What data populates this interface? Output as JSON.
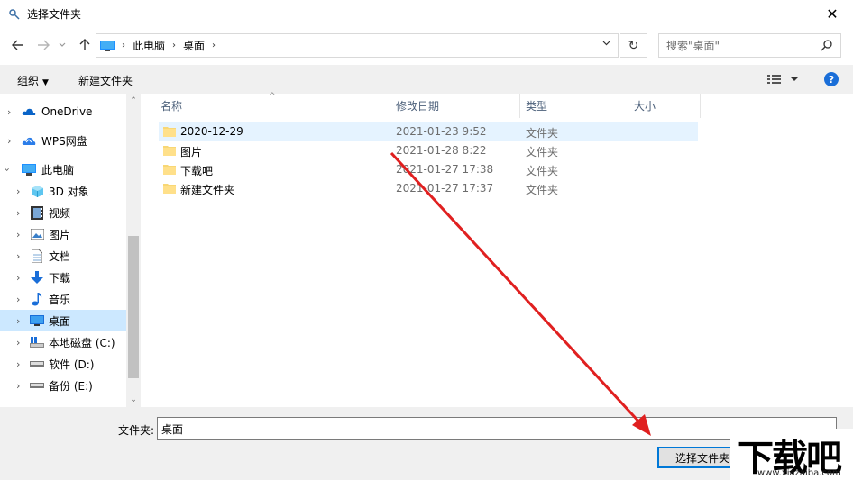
{
  "window": {
    "title": "选择文件夹",
    "close_glyph": "✕"
  },
  "nav": {
    "back_icon": "arrow-left-icon",
    "forward_icon": "arrow-right-icon",
    "recent_icon": "chevron-down-icon",
    "up_icon": "arrow-up-icon"
  },
  "address": {
    "crumbs": [
      "此电脑",
      "桌面"
    ],
    "separator": "›",
    "dropdown": "⌄",
    "refresh": "↻"
  },
  "search": {
    "placeholder": "搜索\"桌面\""
  },
  "toolbar": {
    "organize": "组织",
    "new_folder": "新建文件夹",
    "help": "?"
  },
  "sidebar": {
    "items": [
      {
        "label": "OneDrive",
        "icon": "onedrive-cloud-icon"
      },
      {
        "label": "WPS网盘",
        "icon": "wps-cloud-icon"
      },
      {
        "label": "此电脑",
        "icon": "computer-icon"
      },
      {
        "label": "3D 对象",
        "icon": "3d-objects-icon"
      },
      {
        "label": "视频",
        "icon": "video-icon"
      },
      {
        "label": "图片",
        "icon": "pictures-icon"
      },
      {
        "label": "文档",
        "icon": "documents-icon"
      },
      {
        "label": "下载",
        "icon": "download-icon"
      },
      {
        "label": "音乐",
        "icon": "music-icon"
      },
      {
        "label": "桌面",
        "icon": "desktop-icon",
        "selected": true
      },
      {
        "label": "本地磁盘 (C:)",
        "icon": "system-drive-icon"
      },
      {
        "label": "软件 (D:)",
        "icon": "drive-icon"
      },
      {
        "label": "备份 (E:)",
        "icon": "drive-icon"
      }
    ]
  },
  "columns": {
    "name": "名称",
    "date": "修改日期",
    "type": "类型",
    "size": "大小"
  },
  "files": [
    {
      "name": "2020-12-29",
      "date": "2021-01-23 9:52",
      "type": "文件夹"
    },
    {
      "name": "图片",
      "date": "2021-01-28 8:22",
      "type": "文件夹"
    },
    {
      "name": "下载吧",
      "date": "2021-01-27 17:38",
      "type": "文件夹"
    },
    {
      "name": "新建文件夹",
      "date": "2021-01-27 17:37",
      "type": "文件夹"
    }
  ],
  "footer": {
    "folder_label": "文件夹:",
    "folder_value": "桌面",
    "select_button": "选择文件夹"
  },
  "watermark": {
    "text": "下载吧",
    "url": "www.xiazaiba.com"
  },
  "colors": {
    "accent": "#0078d7",
    "selection": "#cce8ff",
    "hover": "#e5f3ff",
    "annotation_arrow": "#e02020"
  }
}
